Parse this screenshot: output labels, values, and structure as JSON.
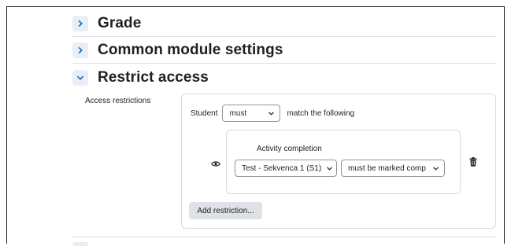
{
  "sections": {
    "grade": {
      "title": "Grade",
      "state": "collapsed"
    },
    "common": {
      "title": "Common module settings",
      "state": "collapsed"
    },
    "restrict": {
      "title": "Restrict access",
      "state": "expanded"
    }
  },
  "restrict_access": {
    "label": "Access restrictions",
    "student_text": "Student",
    "must_select": {
      "value": "must"
    },
    "match_text": "match the following",
    "condition": {
      "type_label": "Activity completion",
      "activity_select": {
        "value": "Test - Sekvenca 1 (S1)"
      },
      "state_select": {
        "value": "must be marked comp"
      }
    },
    "add_button": "Add restriction..."
  },
  "colors": {
    "chevron_bg": "#e7eef8",
    "chevron_fg": "#0f6cbf",
    "border": "#d7dbe0",
    "button_bg": "#dee2e6"
  },
  "icons": {
    "collapsed": "chevron-right-icon",
    "expanded": "chevron-down-icon",
    "visibility": "eye-icon",
    "delete": "trash-icon"
  }
}
